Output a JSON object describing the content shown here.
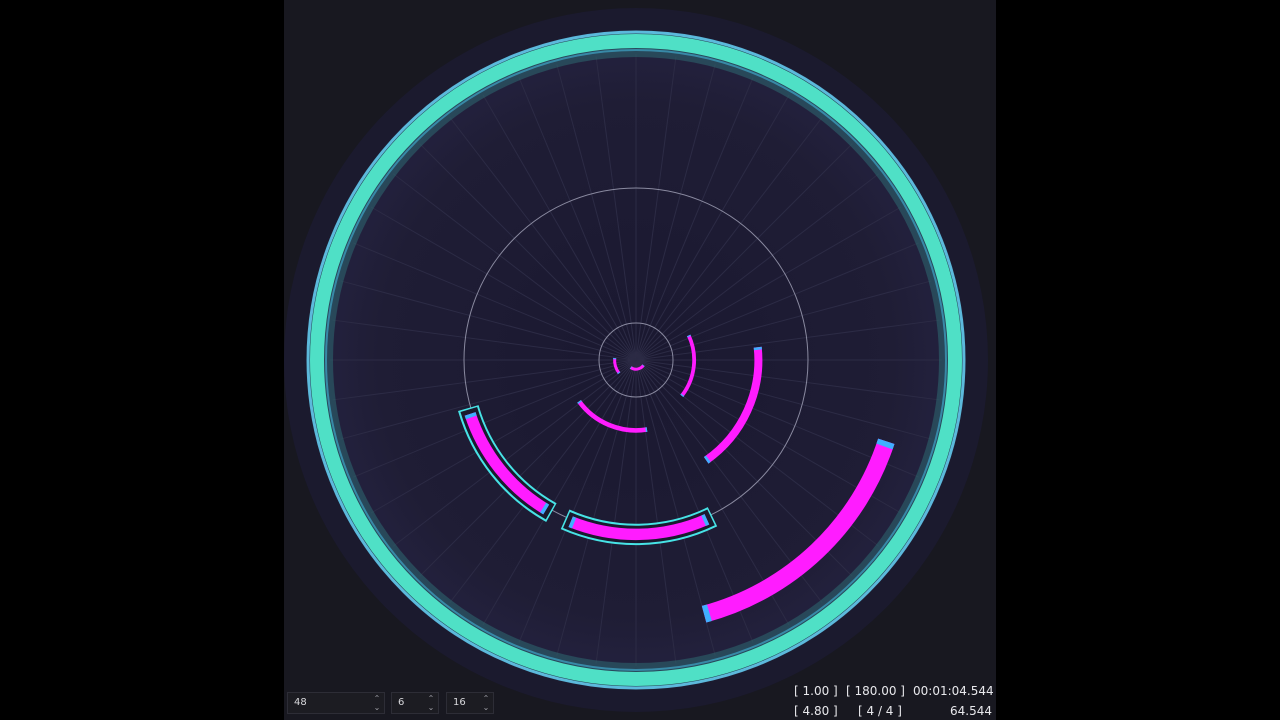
{
  "colors": {
    "background": "#181820",
    "arena": "#1d1b31",
    "outer_ring": "#4fe0c6",
    "note": "#ff1cff",
    "note_cap": "#3fb0ff",
    "selection": "#47e3e6"
  },
  "controls": {
    "spin1_value": "48",
    "spin2_value": "6",
    "spin3_value": "16",
    "up_glyph": "⌃",
    "down_glyph": "⌄"
  },
  "status": {
    "speed": "[ 1.00 ]",
    "bpm": "[ 180.00 ]",
    "time": "00:01:04.544",
    "zoom": "[ 4.80 ]",
    "beat_division": "[ 4 / 4 ]",
    "seconds": "64.544"
  },
  "guide_rings": [
    "inner",
    "mid"
  ],
  "notes": [
    {
      "name": "note-arc-outer",
      "depth": 0.86,
      "start_deg": 108,
      "end_deg": 165
    },
    {
      "name": "note-arc-selected-1",
      "depth": 0.57,
      "start_deg": 211,
      "end_deg": 252,
      "selected": true
    },
    {
      "name": "note-arc-selected-2",
      "depth": 0.57,
      "start_deg": 156,
      "end_deg": 202,
      "selected": true
    },
    {
      "name": "note-arc-mid-right",
      "depth": 0.4,
      "start_deg": 84,
      "end_deg": 145
    },
    {
      "name": "note-arc-mid-bottom",
      "depth": 0.23,
      "start_deg": 171,
      "end_deg": 234
    },
    {
      "name": "note-arc-inner-right",
      "depth": 0.19,
      "start_deg": 65,
      "end_deg": 128
    },
    {
      "name": "note-arc-inner-left",
      "depth": 0.07,
      "start_deg": 232,
      "end_deg": 275
    },
    {
      "name": "note-arc-core",
      "depth": 0.03,
      "start_deg": 125,
      "end_deg": 215
    }
  ]
}
